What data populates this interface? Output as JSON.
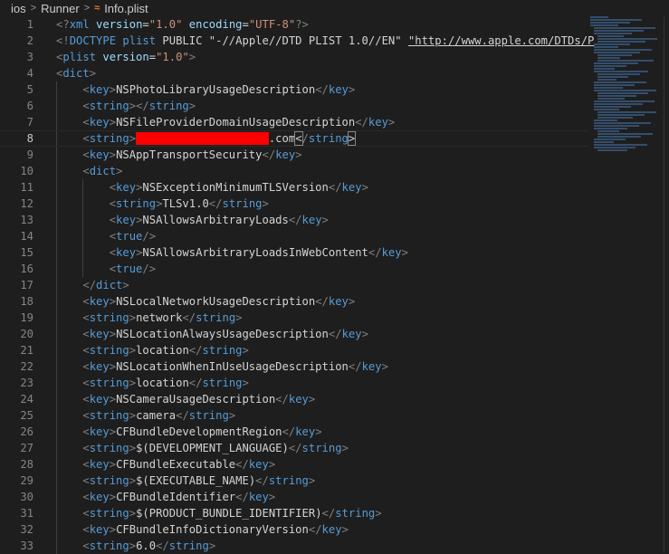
{
  "breadcrumb": {
    "items": [
      "ios",
      "Runner",
      "Info.plist"
    ],
    "separator": ">"
  },
  "current_line": 8,
  "lines": [
    [
      [
        "p",
        "<?"
      ],
      [
        "tag",
        "xml"
      ],
      [
        "txt",
        " "
      ],
      [
        "attr",
        "version"
      ],
      [
        "txt",
        "="
      ],
      [
        "str",
        "\"1.0\""
      ],
      [
        "txt",
        " "
      ],
      [
        "attr",
        "encoding"
      ],
      [
        "txt",
        "="
      ],
      [
        "str",
        "\"UTF-8\""
      ],
      [
        "p",
        "?>"
      ]
    ],
    [
      [
        "p",
        "<!"
      ],
      [
        "tag",
        "DOCTYPE"
      ],
      [
        "txt",
        " "
      ],
      [
        "tag",
        "plist"
      ],
      [
        "txt",
        " PUBLIC \"-//Apple//DTD PLIST 1.0//EN\" "
      ],
      [
        "url",
        "\"http://www.apple.com/DTDs/P"
      ]
    ],
    [
      [
        "p",
        "<"
      ],
      [
        "tag",
        "plist"
      ],
      [
        "txt",
        " "
      ],
      [
        "attr",
        "version"
      ],
      [
        "txt",
        "="
      ],
      [
        "str",
        "\"1.0\""
      ],
      [
        "p",
        ">"
      ]
    ],
    [
      [
        "p",
        "<"
      ],
      [
        "tag",
        "dict"
      ],
      [
        "p",
        ">"
      ]
    ],
    [
      [
        "txt",
        "    "
      ],
      [
        "p",
        "<"
      ],
      [
        "tag",
        "key"
      ],
      [
        "p",
        ">"
      ],
      [
        "txt",
        "NSPhotoLibraryUsageDescription"
      ],
      [
        "p",
        "</"
      ],
      [
        "tag",
        "key"
      ],
      [
        "p",
        ">"
      ]
    ],
    [
      [
        "txt",
        "    "
      ],
      [
        "p",
        "<"
      ],
      [
        "tag",
        "string"
      ],
      [
        "p",
        "></"
      ],
      [
        "tag",
        "string"
      ],
      [
        "p",
        ">"
      ]
    ],
    [
      [
        "txt",
        "    "
      ],
      [
        "p",
        "<"
      ],
      [
        "tag",
        "key"
      ],
      [
        "p",
        ">"
      ],
      [
        "txt",
        "NSFileProviderDomainUsageDescription"
      ],
      [
        "p",
        "</"
      ],
      [
        "tag",
        "key"
      ],
      [
        "p",
        ">"
      ]
    ],
    [
      [
        "txt",
        "    "
      ],
      [
        "p",
        "<"
      ],
      [
        "tag",
        "string"
      ],
      [
        "p",
        ">"
      ],
      [
        "red",
        "xxxxxxxxxxxxxxxxxxxx"
      ],
      [
        "txt",
        ".com"
      ],
      [
        "br",
        "<"
      ],
      [
        "p",
        "/"
      ],
      [
        "tag",
        "string"
      ],
      [
        "br",
        ">"
      ]
    ],
    [
      [
        "txt",
        "    "
      ],
      [
        "p",
        "<"
      ],
      [
        "tag",
        "key"
      ],
      [
        "p",
        ">"
      ],
      [
        "txt",
        "NSAppTransportSecurity"
      ],
      [
        "p",
        "</"
      ],
      [
        "tag",
        "key"
      ],
      [
        "p",
        ">"
      ]
    ],
    [
      [
        "txt",
        "    "
      ],
      [
        "p",
        "<"
      ],
      [
        "tag",
        "dict"
      ],
      [
        "p",
        ">"
      ]
    ],
    [
      [
        "txt",
        "        "
      ],
      [
        "p",
        "<"
      ],
      [
        "tag",
        "key"
      ],
      [
        "p",
        ">"
      ],
      [
        "txt",
        "NSExceptionMinimumTLSVersion"
      ],
      [
        "p",
        "</"
      ],
      [
        "tag",
        "key"
      ],
      [
        "p",
        ">"
      ]
    ],
    [
      [
        "txt",
        "        "
      ],
      [
        "p",
        "<"
      ],
      [
        "tag",
        "string"
      ],
      [
        "p",
        ">"
      ],
      [
        "txt",
        "TLSv1.0"
      ],
      [
        "p",
        "</"
      ],
      [
        "tag",
        "string"
      ],
      [
        "p",
        ">"
      ]
    ],
    [
      [
        "txt",
        "        "
      ],
      [
        "p",
        "<"
      ],
      [
        "tag",
        "key"
      ],
      [
        "p",
        ">"
      ],
      [
        "txt",
        "NSAllowsArbitraryLoads"
      ],
      [
        "p",
        "</"
      ],
      [
        "tag",
        "key"
      ],
      [
        "p",
        ">"
      ]
    ],
    [
      [
        "txt",
        "        "
      ],
      [
        "p",
        "<"
      ],
      [
        "tag",
        "true"
      ],
      [
        "p",
        "/>"
      ]
    ],
    [
      [
        "txt",
        "        "
      ],
      [
        "p",
        "<"
      ],
      [
        "tag",
        "key"
      ],
      [
        "p",
        ">"
      ],
      [
        "txt",
        "NSAllowsArbitraryLoadsInWebContent"
      ],
      [
        "p",
        "</"
      ],
      [
        "tag",
        "key"
      ],
      [
        "p",
        ">"
      ]
    ],
    [
      [
        "txt",
        "        "
      ],
      [
        "p",
        "<"
      ],
      [
        "tag",
        "true"
      ],
      [
        "p",
        "/>"
      ]
    ],
    [
      [
        "txt",
        "    "
      ],
      [
        "p",
        "</"
      ],
      [
        "tag",
        "dict"
      ],
      [
        "p",
        ">"
      ]
    ],
    [
      [
        "txt",
        "    "
      ],
      [
        "p",
        "<"
      ],
      [
        "tag",
        "key"
      ],
      [
        "p",
        ">"
      ],
      [
        "txt",
        "NSLocalNetworkUsageDescription"
      ],
      [
        "p",
        "</"
      ],
      [
        "tag",
        "key"
      ],
      [
        "p",
        ">"
      ]
    ],
    [
      [
        "txt",
        "    "
      ],
      [
        "p",
        "<"
      ],
      [
        "tag",
        "string"
      ],
      [
        "p",
        ">"
      ],
      [
        "txt",
        "network"
      ],
      [
        "p",
        "</"
      ],
      [
        "tag",
        "string"
      ],
      [
        "p",
        ">"
      ]
    ],
    [
      [
        "txt",
        "    "
      ],
      [
        "p",
        "<"
      ],
      [
        "tag",
        "key"
      ],
      [
        "p",
        ">"
      ],
      [
        "txt",
        "NSLocationAlwaysUsageDescription"
      ],
      [
        "p",
        "</"
      ],
      [
        "tag",
        "key"
      ],
      [
        "p",
        ">"
      ]
    ],
    [
      [
        "txt",
        "    "
      ],
      [
        "p",
        "<"
      ],
      [
        "tag",
        "string"
      ],
      [
        "p",
        ">"
      ],
      [
        "txt",
        "location"
      ],
      [
        "p",
        "</"
      ],
      [
        "tag",
        "string"
      ],
      [
        "p",
        ">"
      ]
    ],
    [
      [
        "txt",
        "    "
      ],
      [
        "p",
        "<"
      ],
      [
        "tag",
        "key"
      ],
      [
        "p",
        ">"
      ],
      [
        "txt",
        "NSLocationWhenInUseUsageDescription"
      ],
      [
        "p",
        "</"
      ],
      [
        "tag",
        "key"
      ],
      [
        "p",
        ">"
      ]
    ],
    [
      [
        "txt",
        "    "
      ],
      [
        "p",
        "<"
      ],
      [
        "tag",
        "string"
      ],
      [
        "p",
        ">"
      ],
      [
        "txt",
        "location"
      ],
      [
        "p",
        "</"
      ],
      [
        "tag",
        "string"
      ],
      [
        "p",
        ">"
      ]
    ],
    [
      [
        "txt",
        "    "
      ],
      [
        "p",
        "<"
      ],
      [
        "tag",
        "key"
      ],
      [
        "p",
        ">"
      ],
      [
        "txt",
        "NSCameraUsageDescription"
      ],
      [
        "p",
        "</"
      ],
      [
        "tag",
        "key"
      ],
      [
        "p",
        ">"
      ]
    ],
    [
      [
        "txt",
        "    "
      ],
      [
        "p",
        "<"
      ],
      [
        "tag",
        "string"
      ],
      [
        "p",
        ">"
      ],
      [
        "txt",
        "camera"
      ],
      [
        "p",
        "</"
      ],
      [
        "tag",
        "string"
      ],
      [
        "p",
        ">"
      ]
    ],
    [
      [
        "txt",
        "    "
      ],
      [
        "p",
        "<"
      ],
      [
        "tag",
        "key"
      ],
      [
        "p",
        ">"
      ],
      [
        "txt",
        "CFBundleDevelopmentRegion"
      ],
      [
        "p",
        "</"
      ],
      [
        "tag",
        "key"
      ],
      [
        "p",
        ">"
      ]
    ],
    [
      [
        "txt",
        "    "
      ],
      [
        "p",
        "<"
      ],
      [
        "tag",
        "string"
      ],
      [
        "p",
        ">"
      ],
      [
        "txt",
        "$(DEVELOPMENT_LANGUAGE)"
      ],
      [
        "p",
        "</"
      ],
      [
        "tag",
        "string"
      ],
      [
        "p",
        ">"
      ]
    ],
    [
      [
        "txt",
        "    "
      ],
      [
        "p",
        "<"
      ],
      [
        "tag",
        "key"
      ],
      [
        "p",
        ">"
      ],
      [
        "txt",
        "CFBundleExecutable"
      ],
      [
        "p",
        "</"
      ],
      [
        "tag",
        "key"
      ],
      [
        "p",
        ">"
      ]
    ],
    [
      [
        "txt",
        "    "
      ],
      [
        "p",
        "<"
      ],
      [
        "tag",
        "string"
      ],
      [
        "p",
        ">"
      ],
      [
        "txt",
        "$(EXECUTABLE_NAME)"
      ],
      [
        "p",
        "</"
      ],
      [
        "tag",
        "string"
      ],
      [
        "p",
        ">"
      ]
    ],
    [
      [
        "txt",
        "    "
      ],
      [
        "p",
        "<"
      ],
      [
        "tag",
        "key"
      ],
      [
        "p",
        ">"
      ],
      [
        "txt",
        "CFBundleIdentifier"
      ],
      [
        "p",
        "</"
      ],
      [
        "tag",
        "key"
      ],
      [
        "p",
        ">"
      ]
    ],
    [
      [
        "txt",
        "    "
      ],
      [
        "p",
        "<"
      ],
      [
        "tag",
        "string"
      ],
      [
        "p",
        ">"
      ],
      [
        "txt",
        "$(PRODUCT_BUNDLE_IDENTIFIER)"
      ],
      [
        "p",
        "</"
      ],
      [
        "tag",
        "string"
      ],
      [
        "p",
        ">"
      ]
    ],
    [
      [
        "txt",
        "    "
      ],
      [
        "p",
        "<"
      ],
      [
        "tag",
        "key"
      ],
      [
        "p",
        ">"
      ],
      [
        "txt",
        "CFBundleInfoDictionaryVersion"
      ],
      [
        "p",
        "</"
      ],
      [
        "tag",
        "key"
      ],
      [
        "p",
        ">"
      ]
    ],
    [
      [
        "txt",
        "    "
      ],
      [
        "p",
        "<"
      ],
      [
        "tag",
        "string"
      ],
      [
        "p",
        ">"
      ],
      [
        "txt",
        "6.0"
      ],
      [
        "p",
        "</"
      ],
      [
        "tag",
        "string"
      ],
      [
        "p",
        ">"
      ]
    ]
  ]
}
